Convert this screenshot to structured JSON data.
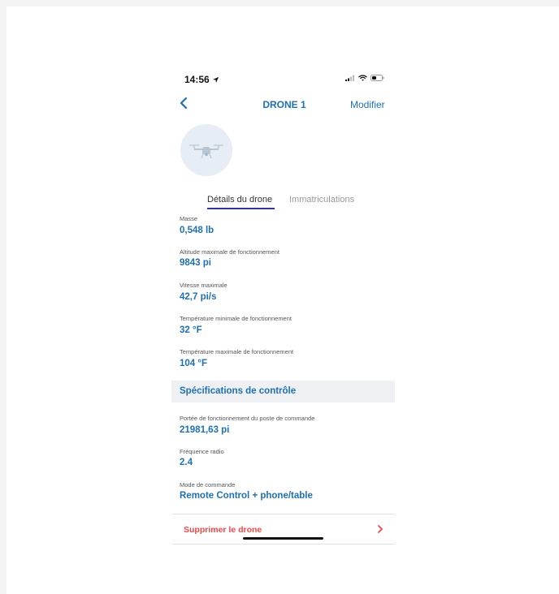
{
  "status_bar": {
    "time": "14:56",
    "location_icon": "location-arrow-icon",
    "signal_icon": "cellular-signal-icon",
    "wifi_icon": "wifi-icon",
    "battery_icon": "battery-icon"
  },
  "nav": {
    "back_icon": "chevron-left-icon",
    "title": "DRONE 1",
    "edit_label": "Modifier"
  },
  "avatar_icon": "drone-icon",
  "tabs": [
    {
      "label": "Détails du drone",
      "active": true
    },
    {
      "label": "Immatriculations",
      "active": false
    }
  ],
  "details": [
    {
      "label": "Masse",
      "value": "0,548 lb"
    },
    {
      "label": "Altitude maximale de fonctionnement",
      "value": "9843 pi"
    },
    {
      "label": "Vitesse maximale",
      "value": "42,7 pi/s"
    },
    {
      "label": "Température minimale de fonctionnement",
      "value": "32 °F"
    },
    {
      "label": "Température maximale de fonctionnement",
      "value": "104 °F"
    }
  ],
  "control_section": {
    "title": "Spécifications de contrôle",
    "items": [
      {
        "label": "Portée de fonctionnement du poste de commande",
        "value": "21981,63 pi"
      },
      {
        "label": "Fréquence radio",
        "value": "2.4"
      },
      {
        "label": "Mode de commande",
        "value": "Remote Control + phone/table"
      }
    ]
  },
  "delete_label": "Supprimer le drone",
  "colors": {
    "accent": "#1f6fb5",
    "tab_underline": "#34359a",
    "danger": "#ec4a4a",
    "section_bg": "#eef0f3",
    "avatar_bg": "#e6edf5"
  }
}
